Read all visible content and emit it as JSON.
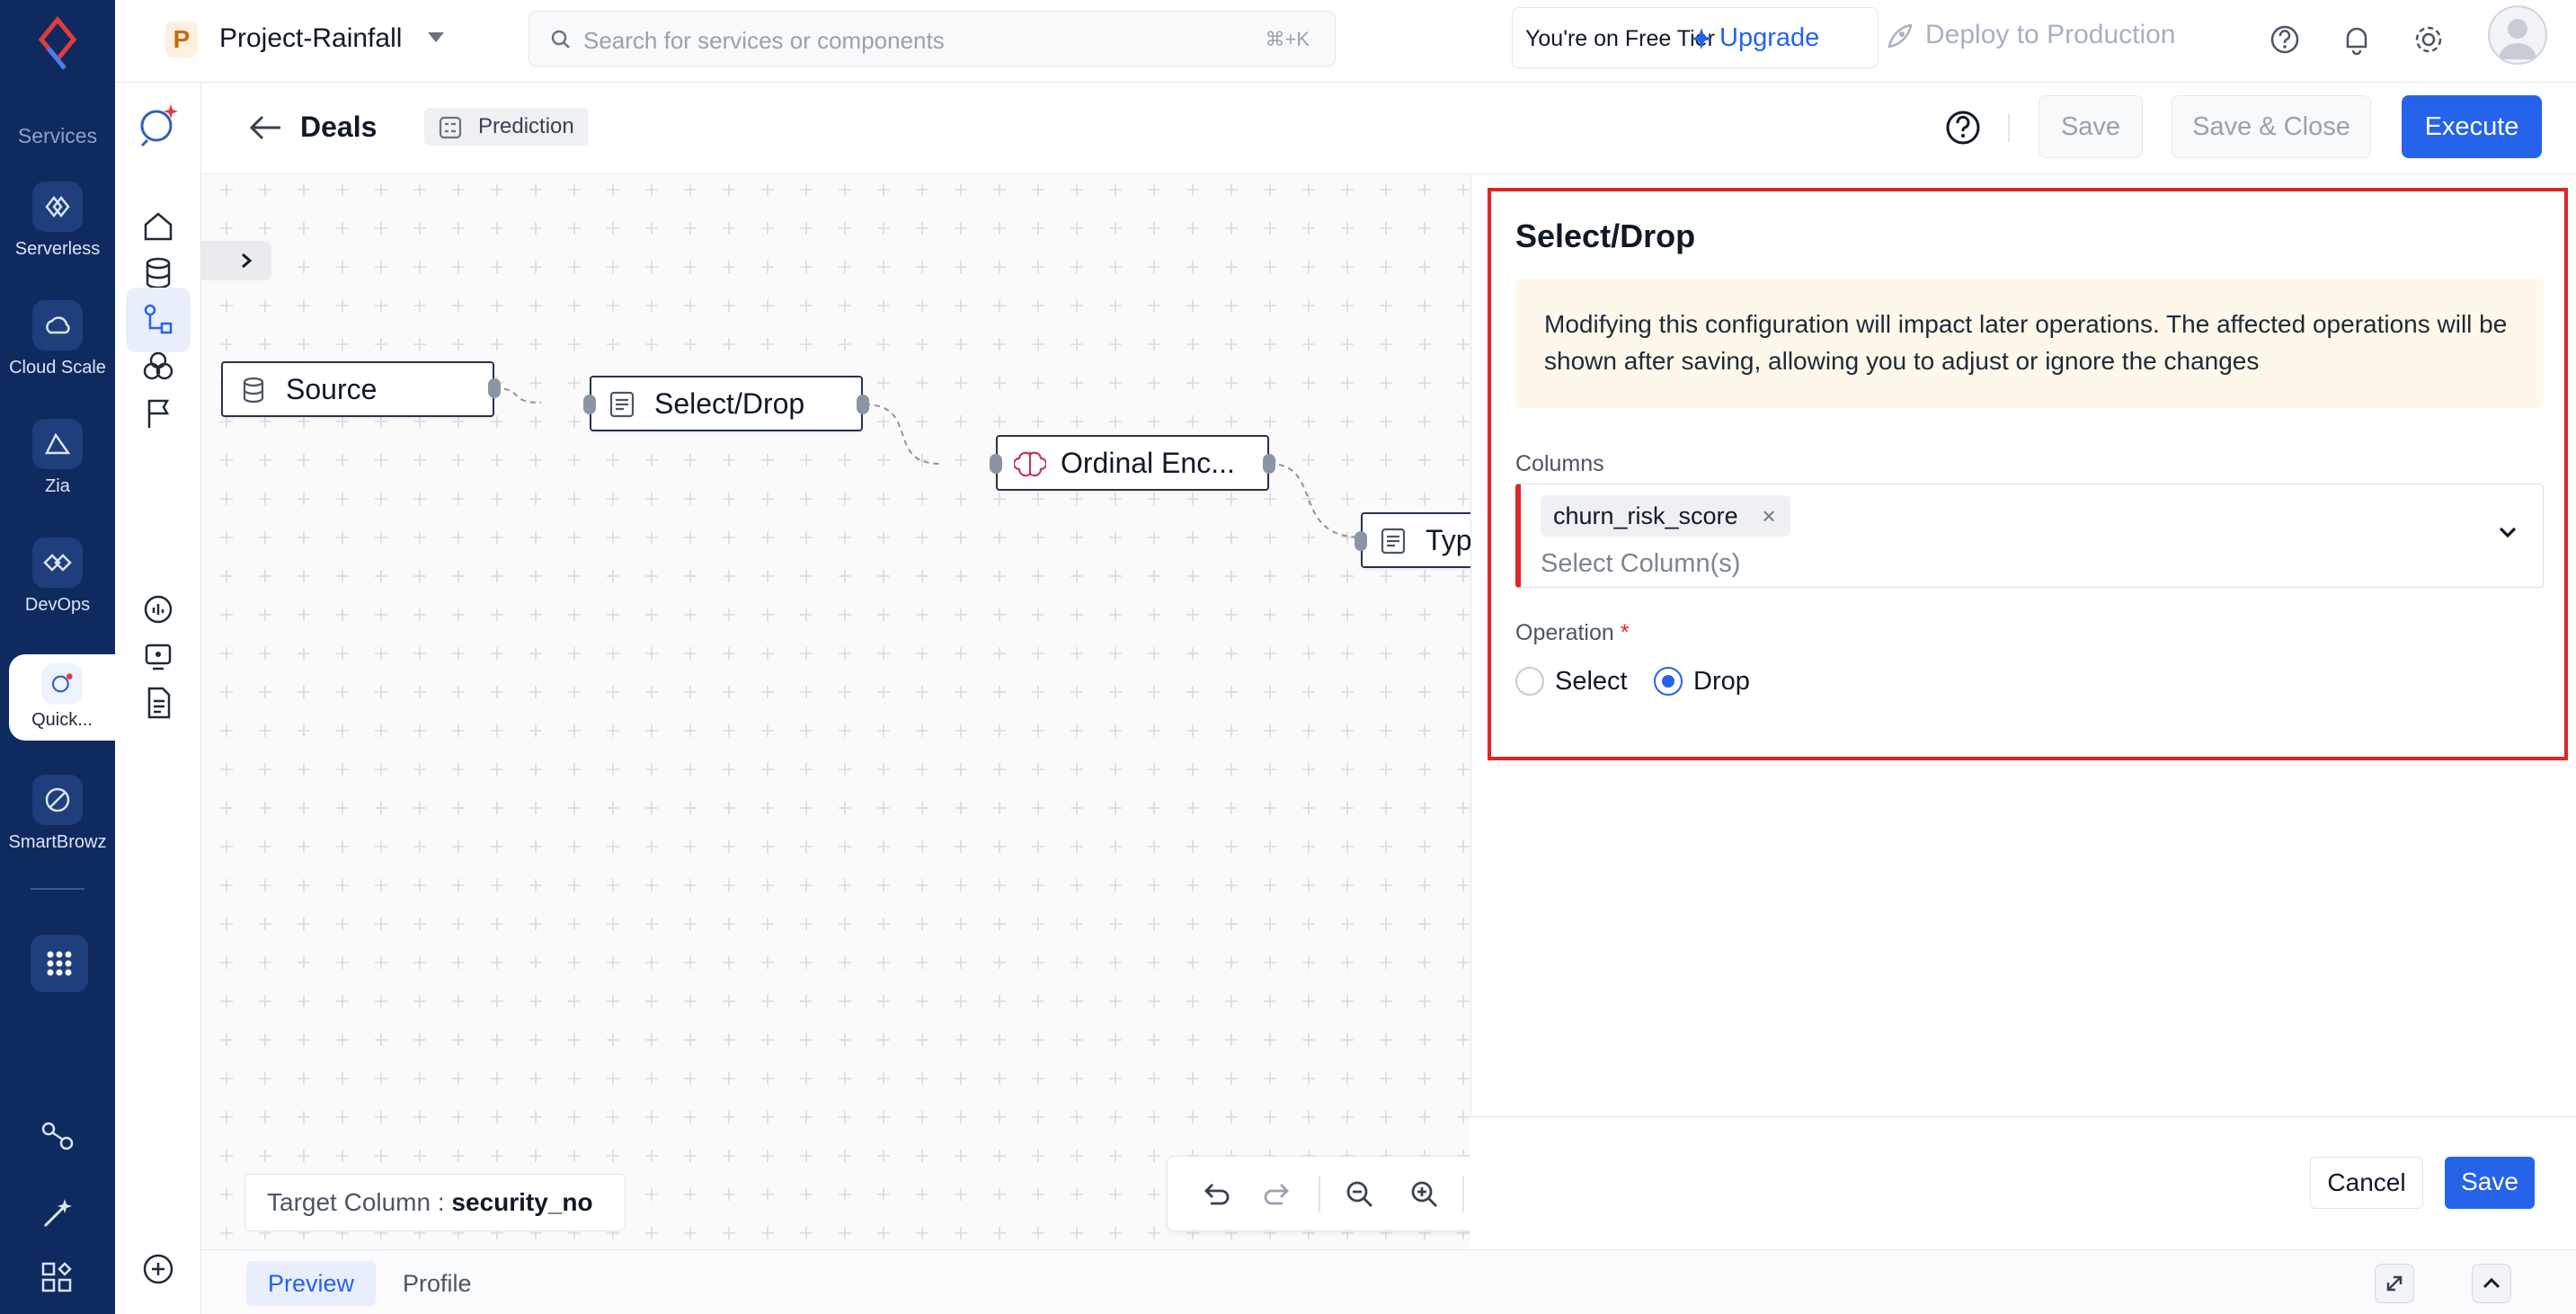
{
  "rail": {
    "section_label": "Services",
    "items": [
      {
        "label": "Serverless"
      },
      {
        "label": "Cloud Scale"
      },
      {
        "label": "Zia"
      },
      {
        "label": "DevOps"
      },
      {
        "label": "Quick..."
      },
      {
        "label": "SmartBrowz"
      }
    ]
  },
  "topbar": {
    "project_badge": "P",
    "project_name": "Project-Rainfall",
    "search_placeholder": "Search for services or components",
    "search_shortcut": "⌘+K",
    "tier_text": "You're on Free Tier",
    "upgrade_label": "Upgrade",
    "deploy_label": "Deploy to Production"
  },
  "subbar": {
    "title": "Deals",
    "badge": "Prediction",
    "save_label": "Save",
    "save_close_label": "Save & Close",
    "execute_label": "Execute"
  },
  "canvas": {
    "nodes": [
      {
        "label": "Source"
      },
      {
        "label": "Select/Drop"
      },
      {
        "label": "Ordinal Enc..."
      },
      {
        "label": "Typ"
      }
    ],
    "target_column_label": "Target Column :",
    "target_column_value": "security_no"
  },
  "bottom_tabs": [
    "Preview",
    "Profile"
  ],
  "panel": {
    "title": "Select/Drop",
    "alert": "Modifying this configuration will impact later operations. The affected operations will be shown after saving, allowing you to adjust or ignore the changes",
    "columns_label": "Columns",
    "selected_chip": "churn_risk_score",
    "columns_placeholder": "Select Column(s)",
    "operation_label": "Operation",
    "operation_required": "*",
    "operation_options": [
      "Select",
      "Drop"
    ],
    "operation_selected": "Drop",
    "cancel_label": "Cancel",
    "save_label": "Save"
  },
  "colors": {
    "primary": "#2563eb",
    "rail": "#0f2a5e",
    "highlight": "#dc2626",
    "alert_bg": "#fef8ea"
  }
}
